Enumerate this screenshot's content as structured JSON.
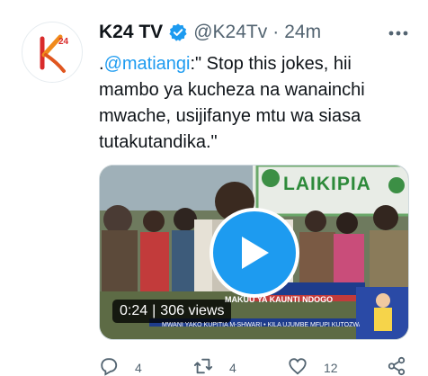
{
  "account": {
    "name": "K24 TV",
    "handle": "@K24Tv",
    "separator": "·",
    "time": "24m",
    "avatar_logo_text": "K24",
    "verified_icon": "verified-badge-icon"
  },
  "tweet": {
    "prefix": ".",
    "mention": "@matiangi",
    "text": ":\" Stop this jokes, hii mambo ya kucheza na wanainchi mwache, usijifanye mtu wa siasa tutakutandika.\""
  },
  "video": {
    "duration": "0:24",
    "separator": "|",
    "views": "306 views",
    "banner_text": "LAIKIPIA",
    "ticker_text": "MAKUU YA KAUNTI NDOGO",
    "ticker_bottom": "MWANI YAKO KUPITIA M-SHWARI  •  KILA UJUMBE MFUPI KUTOZWA KSHS.",
    "play_icon": "play-icon"
  },
  "actions": {
    "reply_count": "4",
    "retweet_count": "4",
    "like_count": "12"
  },
  "colors": {
    "accent": "#1d9bf0",
    "text": "#0f1419",
    "secondary": "#536471",
    "brand_orange": "#f08a1c",
    "brand_red": "#d92b2b"
  }
}
